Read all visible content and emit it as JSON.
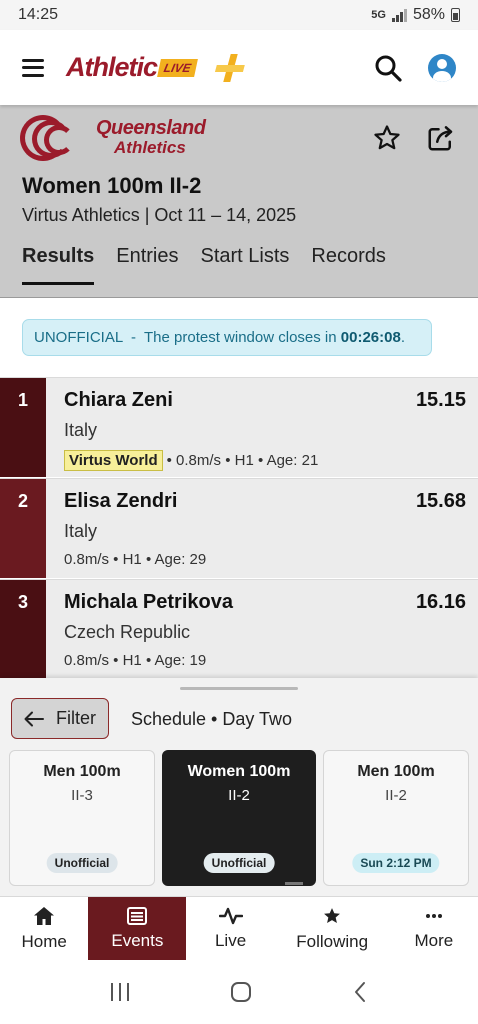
{
  "status_bar": {
    "time": "14:25",
    "network": "5G",
    "battery": "58%"
  },
  "app_header": {
    "logo_text": "Athletic",
    "logo_badge": "LIVE",
    "menu_icon": "hamburger-menu-icon",
    "search_icon": "search-icon",
    "account_icon": "account-circle-icon"
  },
  "event": {
    "org_logo_line1": "Queensland",
    "org_logo_line2": "Athletics",
    "title": "Women 100m II-2",
    "subtitle": "Virtus Athletics | Oct 11 – 14, 2025",
    "favorite_icon": "star-outline-icon",
    "share_icon": "share-icon"
  },
  "tabs": [
    {
      "label": "Results",
      "active": true
    },
    {
      "label": "Entries",
      "active": false
    },
    {
      "label": "Start Lists",
      "active": false
    },
    {
      "label": "Records",
      "active": false
    }
  ],
  "notice": {
    "prefix": "UNOFFICIAL  -  The protest window closes in ",
    "countdown": "00:26:08",
    "suffix": "."
  },
  "results": [
    {
      "place": "1",
      "name": "Chiara Zeni",
      "mark": "15.15",
      "country": "Italy",
      "record_badge": "Virtus World",
      "meta": "• 0.8m/s • H1 • Age: 21",
      "place_color": "#4a0f13"
    },
    {
      "place": "2",
      "name": "Elisa Zendri",
      "mark": "15.68",
      "country": "Italy",
      "record_badge": "",
      "meta": "0.8m/s • H1 • Age: 29",
      "place_color": "#6a1a20"
    },
    {
      "place": "3",
      "name": "Michala Petrikova",
      "mark": "16.16",
      "country": "Czech Republic",
      "record_badge": "",
      "meta": "0.8m/s • H1 • Age: 19",
      "place_color": "#4a0f13"
    }
  ],
  "sheet": {
    "filter_label": "Filter",
    "schedule_label": "Schedule • Day Two",
    "cards": [
      {
        "line1": "Men 100m",
        "line2": "II-3",
        "status": "Unofficial"
      },
      {
        "line1": "Women 100m",
        "line2": "II-2",
        "status": "Unofficial"
      },
      {
        "line1": "Men 100m",
        "line2": "II-2",
        "status": "Sun 2:12 PM"
      }
    ]
  },
  "bottom_nav": [
    {
      "label": "Home",
      "icon": "home-icon"
    },
    {
      "label": "Events",
      "icon": "list-icon"
    },
    {
      "label": "Live",
      "icon": "pulse-icon"
    },
    {
      "label": "Following",
      "icon": "star-icon"
    },
    {
      "label": "More",
      "icon": "more-dots-icon"
    }
  ],
  "colors": {
    "brand": "#9b1b2b",
    "accent": "#f2b01e",
    "active_nav": "#6a1a1f"
  }
}
